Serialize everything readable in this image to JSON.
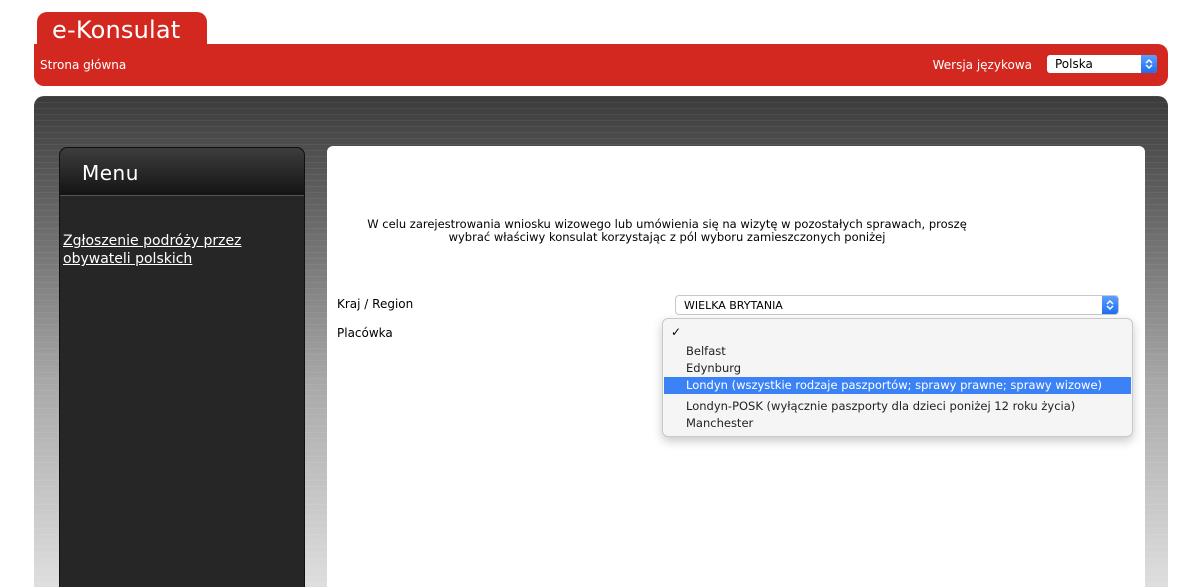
{
  "app": {
    "logo": "e-Konsulat"
  },
  "header": {
    "home_link": "Strona główna",
    "language_label": "Wersja językowa",
    "language_value": "Polska"
  },
  "sidebar": {
    "title": "Menu",
    "items": [
      {
        "label": "Zgłoszenie podróży przez obywateli polskich"
      }
    ]
  },
  "main": {
    "intro_line1": "W celu zarejestrowania wniosku wizowego lub umówienia się na wizytę w pozostałych sprawach, proszę",
    "intro_line2": "wybrać właściwy konsulat korzystając z pól wyboru zamieszczonych poniżej",
    "country_label": "Kraj / Region",
    "country_value": "WIELKA BRYTANIA",
    "post_label": "Placówka"
  },
  "dropdown": {
    "check": "✓",
    "options": [
      {
        "label": "Belfast",
        "selected": false
      },
      {
        "label": "Edynburg",
        "selected": false
      },
      {
        "label": "Londyn (wszystkie rodzaje paszportów; sprawy prawne; sprawy wizowe)",
        "selected": true
      },
      {
        "label": "Londyn-POSK (wyłącznie paszporty dla dzieci poniżej 12 roku życia)",
        "selected": false
      },
      {
        "label": "Manchester",
        "selected": false
      }
    ]
  },
  "colors": {
    "brand_red": "#d3281f",
    "selection_blue": "#3b82f6",
    "sidebar_bg": "#262626"
  },
  "icons": {
    "stepper": "chevron-up-down-icon",
    "check": "checkmark-icon"
  }
}
